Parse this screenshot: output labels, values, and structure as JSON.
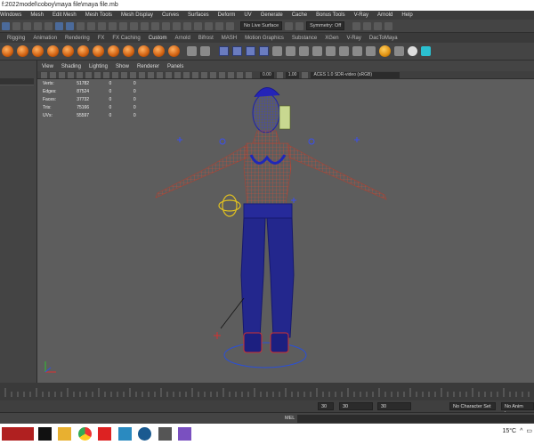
{
  "window": {
    "title": "f:2022model\\coboy\\maya file\\maya file.mb"
  },
  "menubar": {
    "items": [
      "Windows",
      "Mesh",
      "Edit Mesh",
      "Mesh Tools",
      "Mesh Display",
      "Curves",
      "Surfaces",
      "Deform",
      "UV",
      "Generate",
      "Cache",
      "Bonus Tools",
      "V-Ray",
      "Arnold",
      "Help"
    ]
  },
  "statusline": {
    "live_surface": "No Live Surface",
    "symmetry": "Symmetry: Off"
  },
  "shelf": {
    "tabs": [
      "Rigging",
      "Animation",
      "Rendering",
      "FX",
      "FX Caching",
      "Custom",
      "Arnold",
      "Bifrost",
      "MASH",
      "Motion Graphics",
      "Substance",
      "XGen",
      "V-Ray",
      "DacToMaya"
    ],
    "active_tab": "Custom"
  },
  "panel": {
    "menu": [
      "View",
      "Shading",
      "Lighting",
      "Show",
      "Renderer",
      "Panels"
    ],
    "gamma": "0.00",
    "exposure": "1.00",
    "color_space": "ACES 1.0 SDR-video (sRGB)"
  },
  "hud": {
    "rows": [
      {
        "label": "Verts:",
        "v1": "51782",
        "v2": "0",
        "v3": "0"
      },
      {
        "label": "Edges:",
        "v1": "87524",
        "v2": "0",
        "v3": "0"
      },
      {
        "label": "Faces:",
        "v1": "37732",
        "v2": "0",
        "v3": "0"
      },
      {
        "label": "Tris:",
        "v1": "75166",
        "v2": "0",
        "v3": "0"
      },
      {
        "label": "UVs:",
        "v1": "55597",
        "v2": "0",
        "v3": "0"
      }
    ]
  },
  "timeline": {
    "start": "30",
    "end": "30",
    "current": "30"
  },
  "rangebar": {
    "character_set": "No Character Set",
    "anim_layer": "No Anim Layer"
  },
  "commandline": {
    "label": "MEL"
  },
  "taskbar": {
    "weather": "15°C"
  },
  "colors": {
    "viewport_bg": "#5d5d5d",
    "wire": "#2a2fc8",
    "highlight": "#e3553b",
    "accent": "#4b6a9a"
  }
}
